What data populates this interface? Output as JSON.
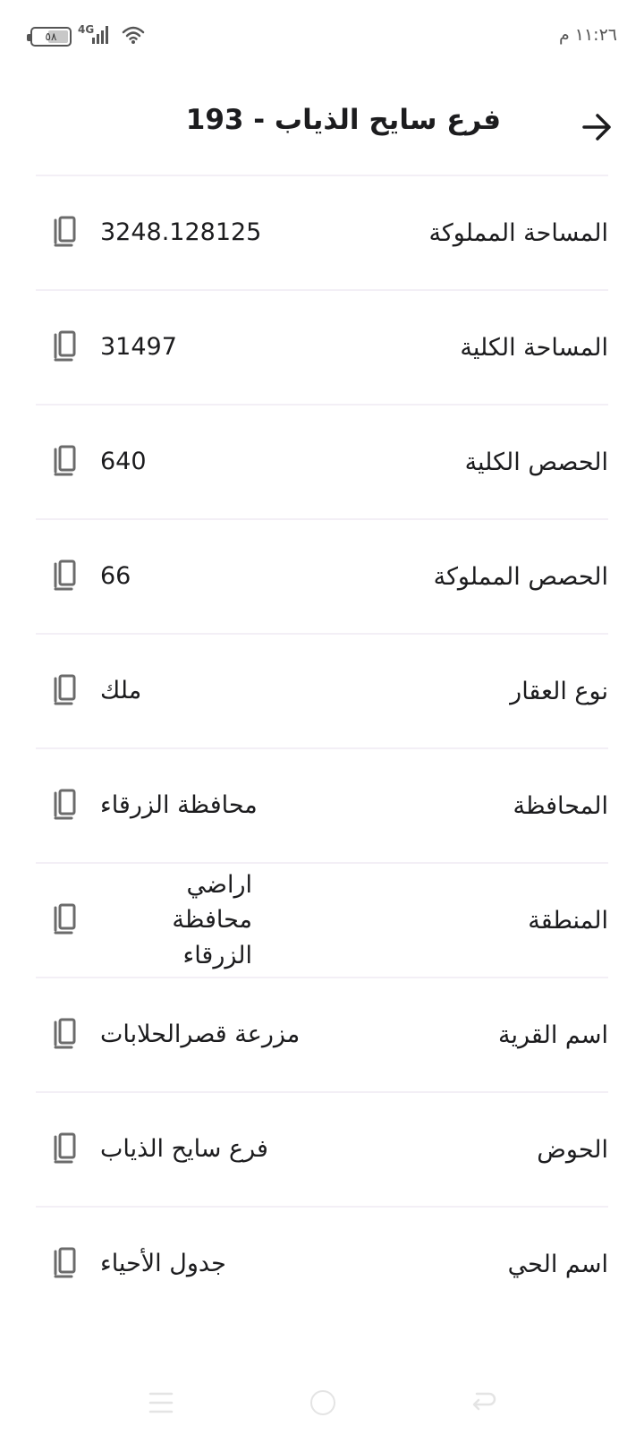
{
  "status_bar": {
    "time": "١١:٢٦ م",
    "battery_level": "٥٨",
    "battery_fraction": 0.58,
    "network_type": "4G",
    "icons": [
      "battery-icon",
      "signal-icon",
      "wifi-icon"
    ]
  },
  "header": {
    "title": "فرع سايح الذياب - 193",
    "back_icon": "arrow-right-icon"
  },
  "rows": [
    {
      "label": "المساحة المملوكة",
      "value": "3248.128125"
    },
    {
      "label": "المساحة الكلية",
      "value": "31497"
    },
    {
      "label": "الحصص الكلية",
      "value": "640"
    },
    {
      "label": "الحصص المملوكة",
      "value": "66"
    },
    {
      "label": "نوع العقار",
      "value": "ملك"
    },
    {
      "label": "المحافظة",
      "value": "محافظة الزرقاء"
    },
    {
      "label": "المنطقة",
      "value": "اراضي محافظة الزرقاء"
    },
    {
      "label": "اسم القرية",
      "value": "مزرعة قصرالحلابات"
    },
    {
      "label": "الحوض",
      "value": "فرع سايح الذياب"
    },
    {
      "label": "اسم الحي",
      "value": "جدول الأحياء"
    }
  ],
  "copy_icon": "copy-icon",
  "nav_bar": {
    "icons": [
      "menu-icon",
      "home-icon",
      "back-icon"
    ]
  },
  "colors": {
    "text": "#1c1c1e",
    "divider": "#f3eff6",
    "icon": "#6b6b6b"
  }
}
